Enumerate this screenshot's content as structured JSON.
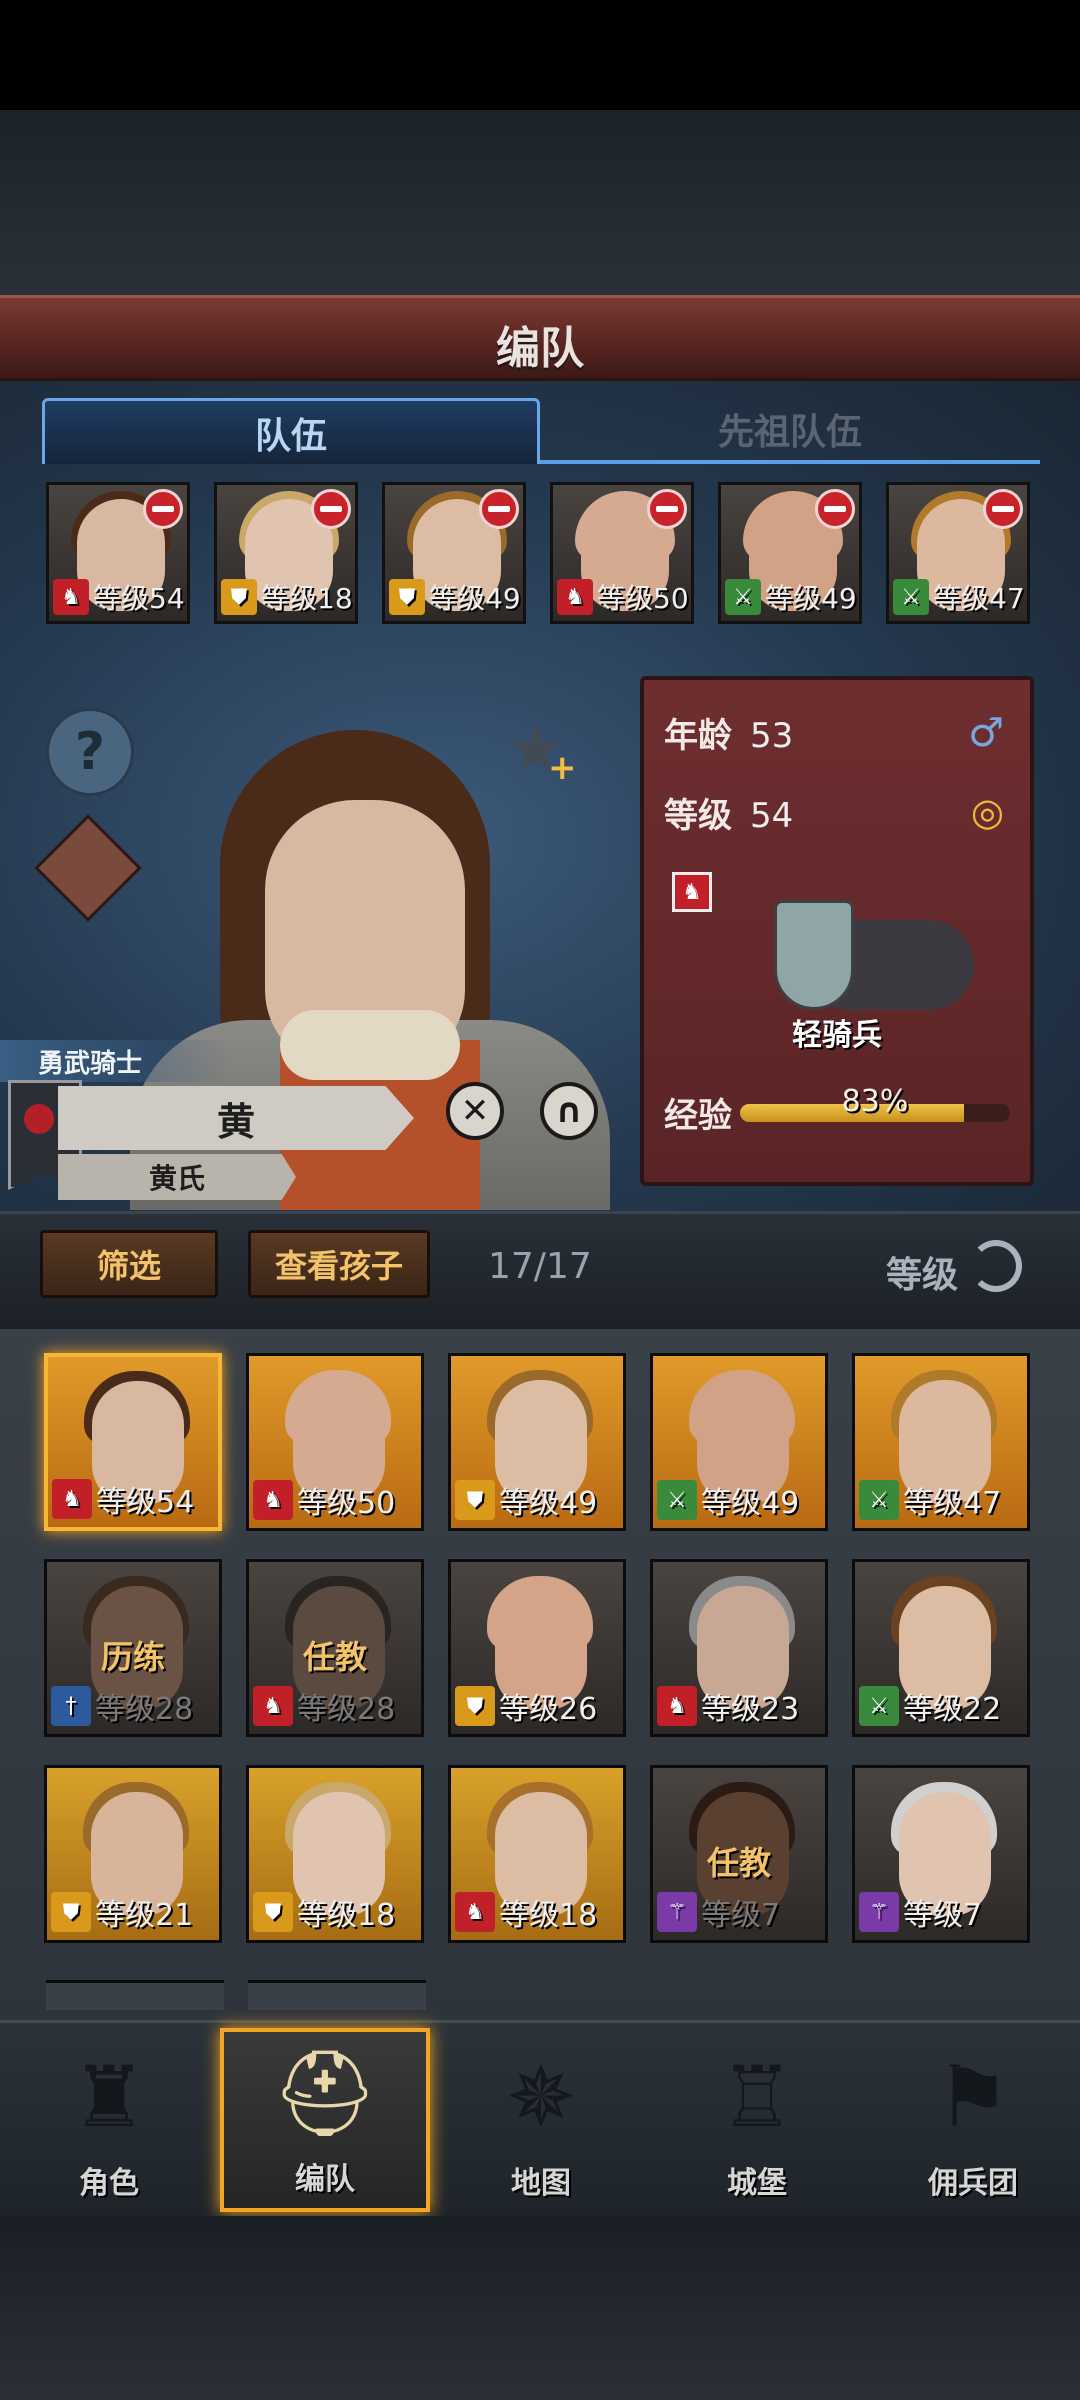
{
  "header": {
    "title": "编队"
  },
  "tabs": [
    {
      "label": "队伍",
      "active": true
    },
    {
      "label": "先祖队伍",
      "active": false
    }
  ],
  "party": [
    {
      "level": "等级54",
      "class_icon": "horse-icon",
      "class_color": "red",
      "hair": "#4a2a18",
      "skin": "#d9b8a2"
    },
    {
      "level": "等级18",
      "class_icon": "shield-icon",
      "class_color": "gold",
      "hair": "#c9a86a",
      "skin": "#e0c4b0"
    },
    {
      "level": "等级49",
      "class_icon": "shield-icon",
      "class_color": "gold",
      "hair": "#9a6a2a",
      "skin": "#dcbca2"
    },
    {
      "level": "等级50",
      "class_icon": "horse-icon",
      "class_color": "red",
      "hair": "#d6aa90",
      "skin": "#d6aa90"
    },
    {
      "level": "等级49",
      "class_icon": "crossed-swords-icon",
      "class_color": "green",
      "hair": "#d2a286",
      "skin": "#d2a286"
    },
    {
      "level": "等级47",
      "class_icon": "crossed-swords-icon",
      "class_color": "green",
      "hair": "#b07a2a",
      "skin": "#dcb89e"
    }
  ],
  "hero": {
    "age_label": "年龄",
    "age": "53",
    "level_label": "等级",
    "level": "54",
    "unit_name": "轻骑兵",
    "exp_label": "经验",
    "exp_text": "83%",
    "exp_fraction": 0.83,
    "title": "勇武骑士",
    "name": "黄",
    "house": "黄氏"
  },
  "toolbar": {
    "filter": "筛选",
    "view_children": "查看孩子",
    "count": "17/17",
    "sort": "等级"
  },
  "roster": [
    {
      "level": "等级54",
      "class_icon": "horse-icon",
      "class_color": "red",
      "hair": "#4a2a18",
      "skin": "#d9b8a2",
      "selected": true,
      "status": ""
    },
    {
      "level": "等级50",
      "class_icon": "horse-icon",
      "class_color": "red",
      "hair": "#d6aa90",
      "skin": "#d6aa90",
      "selected": false,
      "status": ""
    },
    {
      "level": "等级49",
      "class_icon": "shield-icon",
      "class_color": "gold",
      "hair": "#9a6a2a",
      "skin": "#dcbca2",
      "selected": false,
      "status": ""
    },
    {
      "level": "等级49",
      "class_icon": "crossed-swords-icon",
      "class_color": "green",
      "hair": "#d2a286",
      "skin": "#d2a286",
      "selected": false,
      "status": ""
    },
    {
      "level": "等级47",
      "class_icon": "crossed-swords-icon",
      "class_color": "green",
      "hair": "#b07a2a",
      "skin": "#dcb89e",
      "selected": false,
      "status": ""
    },
    {
      "level": "等级28",
      "class_icon": "sword-icon",
      "class_color": "blue",
      "hair": "#3a2a1e",
      "skin": "#6a5244",
      "selected": false,
      "status": "历练"
    },
    {
      "level": "等级28",
      "class_icon": "horse-icon",
      "class_color": "red",
      "hair": "#2a2420",
      "skin": "#5a4a40",
      "selected": false,
      "status": "任教"
    },
    {
      "level": "等级26",
      "class_icon": "shield-icon",
      "class_color": "gold",
      "hair": "#d4a488",
      "skin": "#d4a488",
      "selected": false,
      "status": ""
    },
    {
      "level": "等级23",
      "class_icon": "horse-icon",
      "class_color": "red",
      "hair": "#8a8a8a",
      "skin": "#c8a894",
      "selected": false,
      "status": ""
    },
    {
      "level": "等级22",
      "class_icon": "crossed-swords-icon",
      "class_color": "green",
      "hair": "#6a4220",
      "skin": "#dcbca2",
      "selected": false,
      "status": ""
    },
    {
      "level": "等级21",
      "class_icon": "shield-icon",
      "class_color": "gold",
      "hair": "#9a6a2a",
      "skin": "#d8b49a",
      "selected": false,
      "status": ""
    },
    {
      "level": "等级18",
      "class_icon": "shield-icon",
      "class_color": "gold",
      "hair": "#c9a86a",
      "skin": "#e0c4b0",
      "selected": false,
      "status": ""
    },
    {
      "level": "等级18",
      "class_icon": "horse-icon",
      "class_color": "red",
      "hair": "#a8702a",
      "skin": "#dcbca2",
      "selected": false,
      "status": ""
    },
    {
      "level": "等级7",
      "class_icon": "staff-icon",
      "class_color": "purple",
      "hair": "#2a1c14",
      "skin": "#5a4030",
      "selected": false,
      "status": "任教"
    },
    {
      "level": "等级7",
      "class_icon": "staff-icon",
      "class_color": "purple",
      "hair": "#d0d0d0",
      "skin": "#e0c4b0",
      "selected": false,
      "status": ""
    }
  ],
  "nav": [
    {
      "label": "角色",
      "icon": "knight-icon",
      "active": false
    },
    {
      "label": "编队",
      "icon": "helmet-icon",
      "active": true
    },
    {
      "label": "地图",
      "icon": "compass-icon",
      "active": false
    },
    {
      "label": "城堡",
      "icon": "castle-icon",
      "active": false
    },
    {
      "label": "佣兵团",
      "icon": "banner-icon",
      "active": false
    }
  ],
  "colors": {
    "accent": "#f2a624",
    "tab_border": "#6aa7e8",
    "stat_card": "#6e2e30"
  }
}
